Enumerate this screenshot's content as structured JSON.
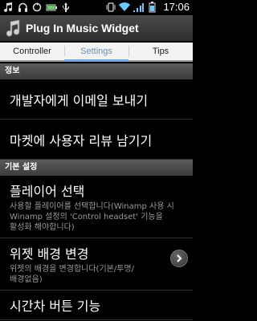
{
  "status_bar": {
    "time": "17:06",
    "left_icons": [
      "music-note-icon",
      "headset-icon",
      "sync-icon",
      "battery-percent-icon",
      "usb-icon"
    ],
    "right_icons": [
      "vibrate-icon",
      "wifi-icon",
      "signal-icon",
      "battery-icon"
    ]
  },
  "title_bar": {
    "title": "Plug In Music Widget",
    "icon": "music-note-icon"
  },
  "tabs": [
    {
      "label": "Controller",
      "active": false
    },
    {
      "label": "Settings",
      "active": true
    },
    {
      "label": "Tips",
      "active": false
    }
  ],
  "sections": [
    {
      "header": "정보",
      "items": [
        {
          "title": "개발자에게 이메일 보내기"
        },
        {
          "title": "마켓에 사용자 리뷰 남기기"
        }
      ]
    },
    {
      "header": "기본 설정",
      "items": [
        {
          "title": "플레이어 선택",
          "summary_lines": [
            "사용할 플레이어를 선택합니다(Winamp 사용 시",
            "Winamp 설정의 'Control headset' 기능을",
            "활성화 해야합니다)"
          ]
        },
        {
          "title": "위젯 배경 변경",
          "summary_lines": [
            "위젯의 배경을 변경합니다(기본/투명/",
            "배경없음)"
          ],
          "icon": "chevron-right-icon"
        },
        {
          "title": "시간차 버튼 기능"
        }
      ]
    }
  ]
}
